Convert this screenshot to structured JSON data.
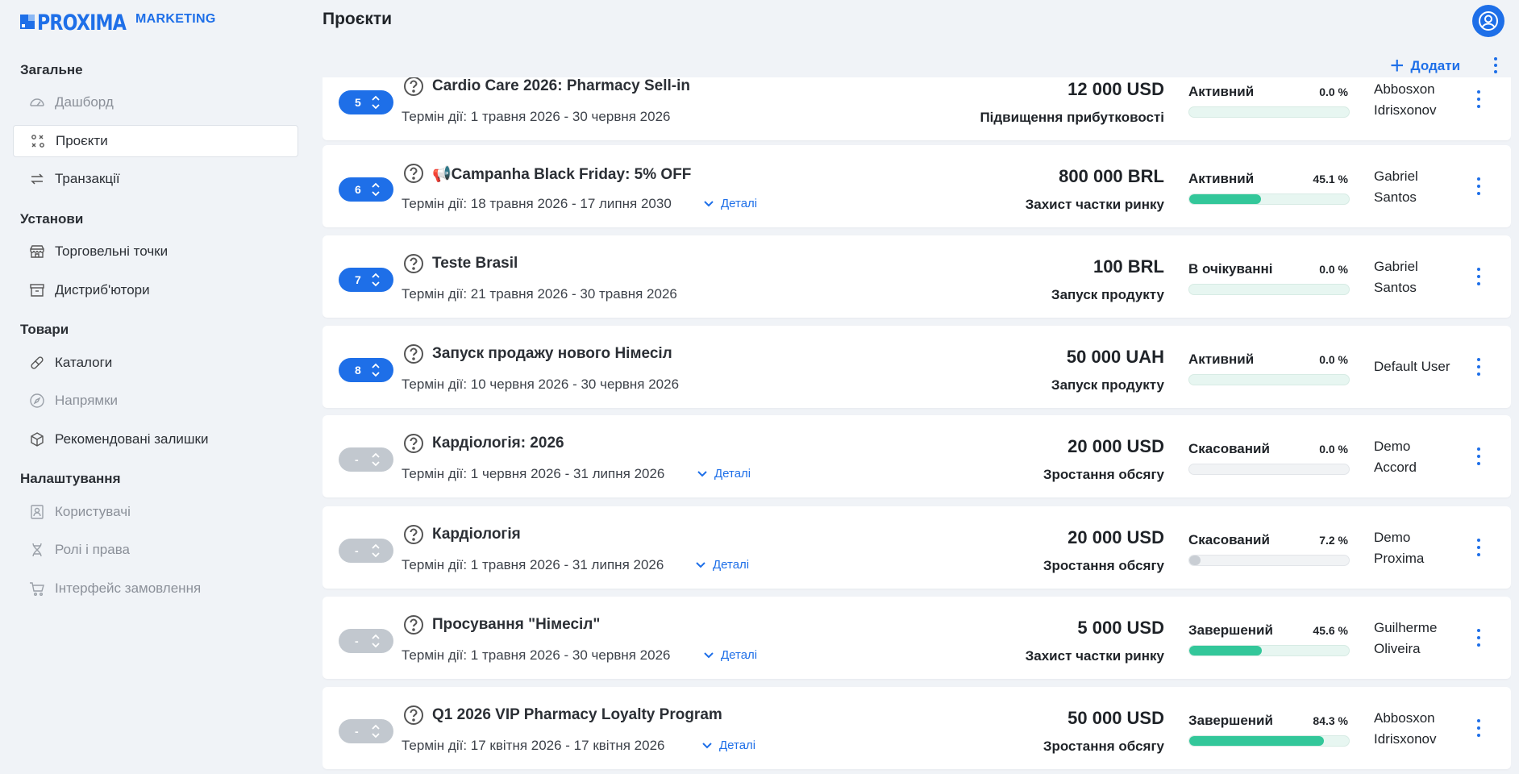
{
  "brand": {
    "name": "PROXIMA",
    "suffix": "MARKETING",
    "color": "#1e6fe8"
  },
  "header": {
    "title": "Проєкти",
    "add_label": "Додати"
  },
  "sidebar": {
    "sections": [
      {
        "title": "Загальне",
        "items": [
          {
            "label": "Дашборд",
            "icon": "dashboard-icon",
            "muted": true
          },
          {
            "label": "Проєкти",
            "icon": "projects-icon",
            "active": true
          },
          {
            "label": "Транзакції",
            "icon": "transfer-icon"
          }
        ]
      },
      {
        "title": "Установи",
        "items": [
          {
            "label": "Торговельні точки",
            "icon": "store-icon"
          },
          {
            "label": "Дистриб'ютори",
            "icon": "archive-icon"
          }
        ]
      },
      {
        "title": "Товари",
        "items": [
          {
            "label": "Каталоги",
            "icon": "pill-icon"
          },
          {
            "label": "Напрямки",
            "icon": "compass-icon",
            "muted": true
          },
          {
            "label": "Рекомендовані залишки",
            "icon": "box-icon"
          }
        ]
      },
      {
        "title": "Налаштування",
        "items": [
          {
            "label": "Користувачі",
            "icon": "user-card-icon",
            "muted": true
          },
          {
            "label": "Ролі і права",
            "icon": "dna-icon",
            "muted": true
          },
          {
            "label": "Інтерфейс замовлення",
            "icon": "cart-icon",
            "muted": true
          }
        ]
      }
    ]
  },
  "term_prefix": "Термін дії:",
  "details_label": "Деталі",
  "projects": [
    {
      "priority": "5",
      "title": "Cardio Care 2026: Pharmacy Sell-in",
      "term": "Термін дії: 1 травня 2026 - 30 червня 2026",
      "details": false,
      "amount": "12 000 USD",
      "purpose": "Підвищення прибутковості",
      "status": "Активний",
      "percent": "0.0 %",
      "progress": 0.0,
      "owner": [
        "Abbosxon",
        "Idrisxonov"
      ],
      "active": true
    },
    {
      "priority": "6",
      "title": "📢Campanha Black Friday: 5% OFF",
      "term": "Термін дії: 18 травня 2026 - 17 липня 2030",
      "details": true,
      "amount": "800 000 BRL",
      "purpose": "Захист частки ринку",
      "status": "Активний",
      "percent": "45.1 %",
      "progress": 0.451,
      "owner": [
        "Gabriel",
        "Santos"
      ],
      "active": true
    },
    {
      "priority": "7",
      "title": "Teste Brasil",
      "term": "Термін дії: 21 травня 2026 - 30 травня 2026",
      "details": false,
      "amount": "100 BRL",
      "purpose": "Запуск продукту",
      "status": "В очікуванні",
      "percent": "0.0 %",
      "progress": 0.0,
      "owner": [
        "Gabriel",
        "Santos"
      ],
      "active": true
    },
    {
      "priority": "8",
      "title": "Запуск продажу нового Німесіл",
      "term": "Термін дії: 10 червня 2026 - 30 червня 2026",
      "details": false,
      "amount": "50 000 UAH",
      "purpose": "Запуск продукту",
      "status": "Активний",
      "percent": "0.0 %",
      "progress": 0.0,
      "owner": [
        "Default User"
      ],
      "active": true
    },
    {
      "priority": "-",
      "title": "Кардіологія: 2026",
      "term": "Термін дії: 1 червня 2026 - 31 липня 2026",
      "details": true,
      "amount": "20 000 USD",
      "purpose": "Зростання обсягу",
      "status": "Скасований",
      "percent": "0.0 %",
      "progress": 0.0,
      "owner": [
        "Demo",
        "Accord"
      ],
      "active": false
    },
    {
      "priority": "-",
      "title": "Кардіологія",
      "term": "Термін дії: 1 травня 2026 - 31 липня 2026",
      "details": true,
      "amount": "20 000 USD",
      "purpose": "Зростання обсягу",
      "status": "Скасований",
      "percent": "7.2 %",
      "progress": 0.072,
      "owner": [
        "Demo",
        "Proxima"
      ],
      "active": false
    },
    {
      "priority": "-",
      "title": "Просування \"Німесіл\"",
      "term": "Термін дії: 1 травня 2026 - 30 червня 2026",
      "details": true,
      "amount": "5 000 USD",
      "purpose": "Захист частки ринку",
      "status": "Завершений",
      "percent": "45.6 %",
      "progress": 0.456,
      "owner": [
        "Guilherme",
        "Oliveira"
      ],
      "active": false
    },
    {
      "priority": "-",
      "title": "Q1 2026 VIP Pharmacy Loyalty Program",
      "term": "Термін дії: 17 квітня 2026 - 17 квітня 2026",
      "details": true,
      "amount": "50 000 USD",
      "purpose": "Зростання обсягу",
      "status": "Завершений",
      "percent": "84.3 %",
      "progress": 0.843,
      "owner": [
        "Abbosxon",
        "Idrisxonov"
      ],
      "active": false
    }
  ]
}
